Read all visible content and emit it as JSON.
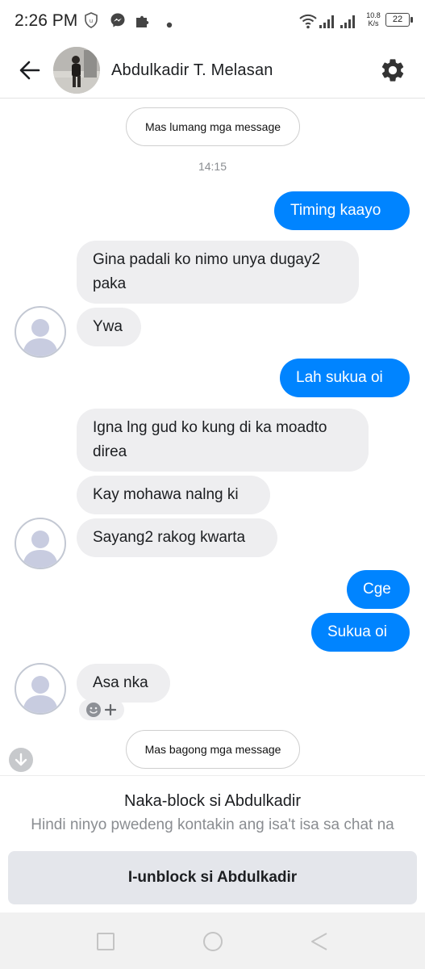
{
  "status_bar": {
    "time": "2:26 PM",
    "network_speed_value": "10.8",
    "network_speed_unit": "K/s",
    "battery": "22",
    "icons": [
      "shield-icon",
      "messenger-icon",
      "puzzle-icon",
      "dot-icon",
      "wifi-icon",
      "signal-icon"
    ]
  },
  "header": {
    "contact_name": "Abdulkadir T. Melasan",
    "icons": [
      "back-arrow-icon",
      "gear-icon"
    ]
  },
  "chat": {
    "older_messages_label": "Mas lumang mga message",
    "timestamp": "14:15",
    "messages": [
      {
        "direction": "outgoing",
        "text": "Timing kaayo"
      },
      {
        "direction": "incoming",
        "text": "Gina padali ko nimo unya dugay2 paka"
      },
      {
        "direction": "incoming",
        "text": "Ywa"
      },
      {
        "direction": "outgoing",
        "text": "Lah sukua oi"
      },
      {
        "direction": "incoming",
        "text": "Igna lng gud ko kung di ka moadto direa"
      },
      {
        "direction": "incoming",
        "text": "Kay mohawa nalng ki"
      },
      {
        "direction": "incoming",
        "text": "Sayang2 rakog kwarta"
      },
      {
        "direction": "outgoing",
        "text": "Cge"
      },
      {
        "direction": "outgoing",
        "text": "Sukua oi"
      },
      {
        "direction": "incoming",
        "text": "Asa nka"
      }
    ],
    "newer_messages_label": "Mas bagong mga message",
    "reaction_icons": [
      "smiley-icon",
      "plus-icon"
    ]
  },
  "blocked": {
    "title": "Naka-block si Abdulkadir",
    "subtitle": "Hindi ninyo pwedeng kontakin ang isa't isa sa chat na",
    "unblock_button": "I-unblock si Abdulkadir"
  },
  "navbar": {
    "icons": [
      "recent-apps-icon",
      "home-icon",
      "back-icon"
    ]
  },
  "colors": {
    "outgoing_bubble": "#0084ff",
    "incoming_bubble": "#eeeef0",
    "button_bg": "#e4e6eb"
  }
}
